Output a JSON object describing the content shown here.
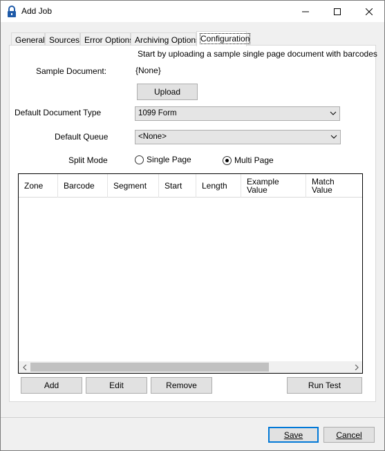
{
  "window": {
    "title": "Add Job"
  },
  "tabs": [
    "General",
    "Sources",
    "Error Options",
    "Archiving Options",
    "Configuration"
  ],
  "config": {
    "hint": "Start by uploading a sample single page document with barcodes",
    "sample_document_label": "Sample Document:",
    "sample_document_value": "{None}",
    "upload_label": "Upload",
    "default_doc_type_label": "Default Document Type",
    "default_doc_type_value": "1099 Form",
    "default_queue_label": "Default Queue",
    "default_queue_value": "<None>",
    "split_mode_label": "Split Mode",
    "split_options": [
      "Single Page",
      "Multi Page"
    ],
    "split_selected": "Multi Page"
  },
  "grid": {
    "columns": [
      "Zone",
      "Barcode",
      "Segment",
      "Start",
      "Length",
      "Example\nValue",
      "Match\nValue"
    ],
    "rows": []
  },
  "actions": {
    "add": "Add",
    "edit": "Edit",
    "remove": "Remove",
    "run_test": "Run Test"
  },
  "footer": {
    "save": "Save",
    "cancel": "Cancel"
  }
}
